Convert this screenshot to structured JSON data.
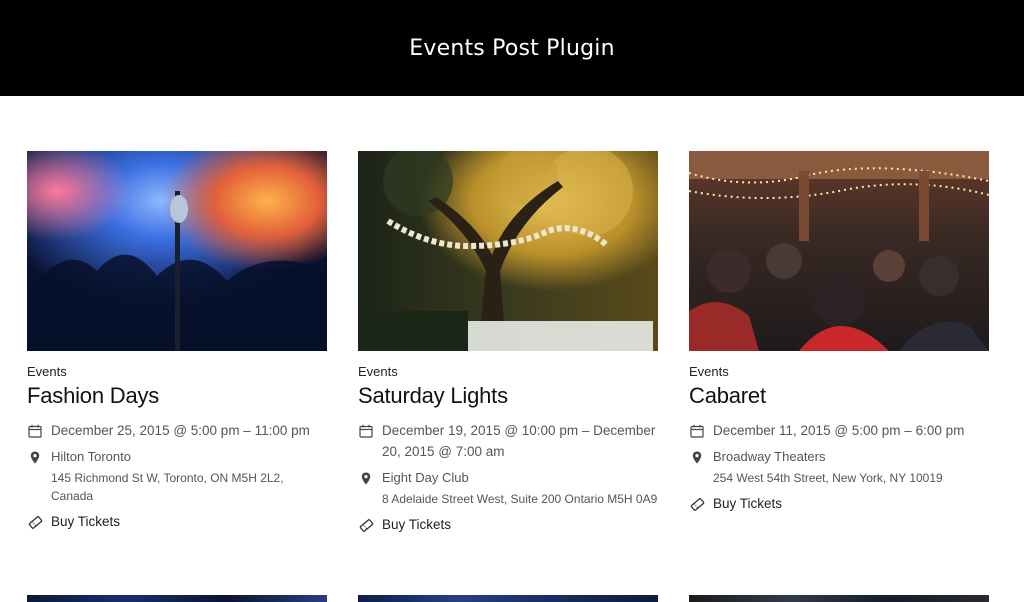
{
  "header": {
    "title": "Events Post Plugin"
  },
  "events": [
    {
      "category": "Events",
      "title": "Fashion Days",
      "date": "December 25, 2015 @ 5:00 pm – 11:00 pm",
      "venue": "Hilton Toronto",
      "address": "145 Richmond St W, Toronto, ON M5H 2L2, Canada",
      "buy_label": "Buy Tickets"
    },
    {
      "category": "Events",
      "title": "Saturday Lights",
      "date": "December 19, 2015 @ 10:00 pm – December 20, 2015 @ 7:00 am",
      "venue": "Eight Day Club",
      "address": "8 Adelaide Street West, Suite 200 Ontario M5H 0A9",
      "buy_label": "Buy Tickets"
    },
    {
      "category": "Events",
      "title": "Cabaret",
      "date": "December 11, 2015 @ 5:00 pm – 6:00 pm",
      "venue": "Broadway Theaters",
      "address": "254 West 54th Street, New York, NY 10019",
      "buy_label": "Buy Tickets"
    }
  ],
  "icons": {
    "date": "calendar-icon",
    "venue": "map-pin-icon",
    "tickets": "ticket-icon"
  },
  "colors": {
    "header_bg": "#000000",
    "header_text": "#ffffff",
    "meta_text": "#555555"
  }
}
